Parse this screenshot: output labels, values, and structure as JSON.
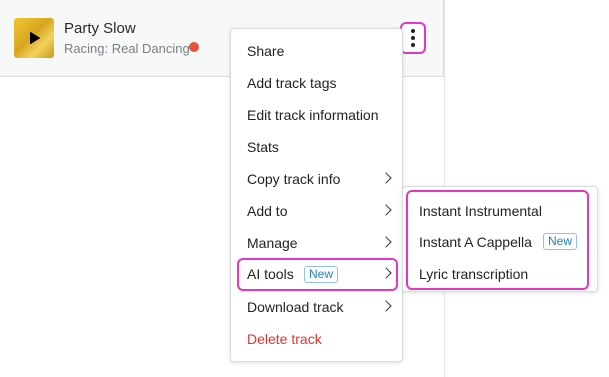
{
  "track": {
    "title": "Party Slow",
    "subtitle": "Racing: Real Dancing"
  },
  "colors": {
    "highlight": "#e535c9",
    "danger": "#e5332a",
    "badge": "#1f7fc4",
    "status_dot": "#e5533d"
  },
  "menu": {
    "items": [
      {
        "label": "Share"
      },
      {
        "label": "Add track tags"
      },
      {
        "label": "Edit track information"
      },
      {
        "label": "Stats"
      },
      {
        "label": "Copy track info"
      },
      {
        "label": "Add to"
      },
      {
        "label": "Manage"
      },
      {
        "label": "AI tools",
        "badge": "New"
      },
      {
        "label": "Download track"
      },
      {
        "label": "Delete track"
      }
    ]
  },
  "submenu": {
    "items": [
      {
        "label": "Instant Instrumental"
      },
      {
        "label": "Instant A Cappella",
        "badge": "New"
      },
      {
        "label": "Lyric transcription"
      }
    ]
  }
}
